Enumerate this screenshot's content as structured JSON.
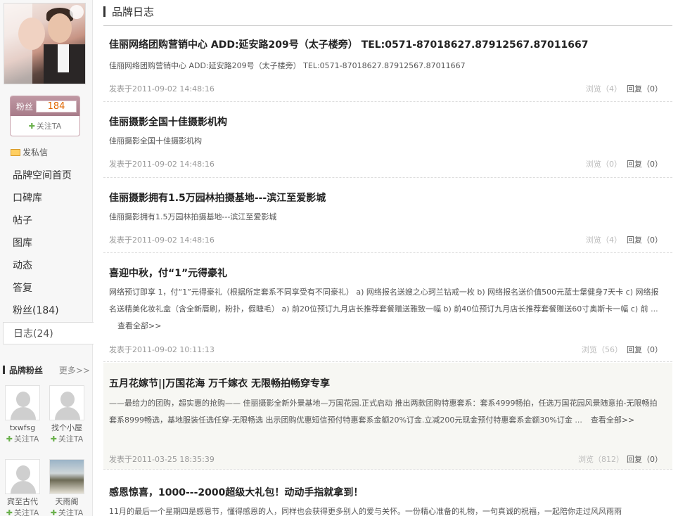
{
  "sidebar": {
    "fans_label": "粉丝",
    "fans_count": "184",
    "follow_label": "关注TA",
    "pm_label": "发私信",
    "nav": [
      "品牌空间首页",
      "口碑库",
      "帖子",
      "图库",
      "动态",
      "答复",
      "粉丝(184)",
      "日志(24)"
    ],
    "fans_section_title": "品牌粉丝",
    "more_label": "更多>>",
    "fans": [
      {
        "name": "txwfsg",
        "follow": "关注TA",
        "avatar": "default"
      },
      {
        "name": "找个小屋",
        "follow": "关注TA",
        "avatar": "default"
      },
      {
        "name": "宾至古代",
        "follow": "关注TA",
        "avatar": "default"
      },
      {
        "name": "天雨阁",
        "follow": "关注TA",
        "avatar": "landscape"
      }
    ]
  },
  "main": {
    "header": "品牌日志",
    "read_more": "查看全部>>",
    "posts": [
      {
        "title": "佳丽网络团购营销中心 ADD:延安路209号（太子楼旁） TEL:0571-87018627.87912567.87011667",
        "body": "佳丽网络团购营销中心 ADD:延安路209号（太子楼旁） TEL:0571-87018627.87912567.87011667",
        "date": "发表于2011-09-02 14:48:16",
        "views": "浏览（4）",
        "replies": "回复（0）"
      },
      {
        "title": "佳丽摄影全国十佳摄影机构",
        "body": "佳丽摄影全国十佳摄影机构",
        "date": "发表于2011-09-02 14:48:16",
        "views": "浏览（0）",
        "replies": "回复（0）"
      },
      {
        "title": "佳丽摄影拥有1.5万园林拍摄基地---滨江至爱影城",
        "body": "佳丽摄影拥有1.5万园林拍摄基地---滨江至爱影城",
        "date": "发表于2011-09-02 14:48:16",
        "views": "浏览（4）",
        "replies": "回复（0）"
      },
      {
        "title": "喜迎中秋，付“1”元得豪礼",
        "body": "网络预订即享 1，付“1”元得豪礼（根据所定套系不同享受有不同豪礼） a) 网络报名送嫂之心珂兰钻戒一枚 b) 网络报名送价值500元蓝士堡健身7天卡 c) 网络报名送精美化妆礼盒（含全新唇刷，粉扑，假睫毛） a) 前20位预订九月店长推荐套餐赠送雅致一幅 b) 前40位预订九月店长推荐套餐赠送60寸奥斯卡一幅 c) 前 ...",
        "date": "发表于2011-09-02 10:11:13",
        "views": "浏览（56）",
        "replies": "回复（0）"
      },
      {
        "title": "五月花嫁节||万国花海 万千嫁衣 无限畅拍畅穿专享",
        "body": "——最给力的团购，超实惠的抢购—— 佳丽摄影全新外景基地—万国花园.正式启动 推出两款团购特惠套系：套系4999畅拍，任选万国花园风景随意拍-无限畅拍 套系8999畅选，基地服装任选任穿-无限畅选 出示团购优惠短信预付特惠套系金额20%订金.立减200元现金预付特惠套系金额30%订金 ...",
        "date": "发表于2011-03-25 18:35:39",
        "views": "浏览（812）",
        "replies": "回复（0）"
      },
      {
        "title": "感恩惊喜，1000---2000超级大礼包！动动手指就拿到！",
        "body": "11月的最后一个星期四是感恩节，懂得感恩的人，同样也会获得更多别人的爱与关怀。一份精心准备的礼物，一句真诚的祝福，一起陪你走过风风雨雨",
        "date": "",
        "views": "",
        "replies": ""
      }
    ]
  }
}
